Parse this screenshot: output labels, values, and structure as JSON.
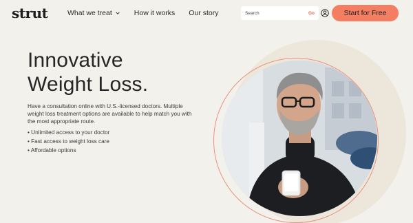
{
  "brand": {
    "logo_text": "strut",
    "accent_color": "#f37e62"
  },
  "nav": {
    "items": [
      {
        "label": "What we treat",
        "has_dropdown": true
      },
      {
        "label": "How it works",
        "has_dropdown": false
      },
      {
        "label": "Our story",
        "has_dropdown": false
      }
    ]
  },
  "search": {
    "placeholder": "Search",
    "value": "",
    "go_label": "Go"
  },
  "header": {
    "account_icon": "user-circle-icon",
    "cta_label": "Start for Free"
  },
  "hero": {
    "title_line1": "Innovative",
    "title_line2": "Weight Loss.",
    "description": "Have a consultation online with U.S.-licensed doctors. Multiple weight loss treatment options are available to help match you with the most appropriate route.",
    "bullets": [
      "Unlimited access to your doctor",
      "Fast access to weight loss care",
      "Affordable options"
    ]
  }
}
